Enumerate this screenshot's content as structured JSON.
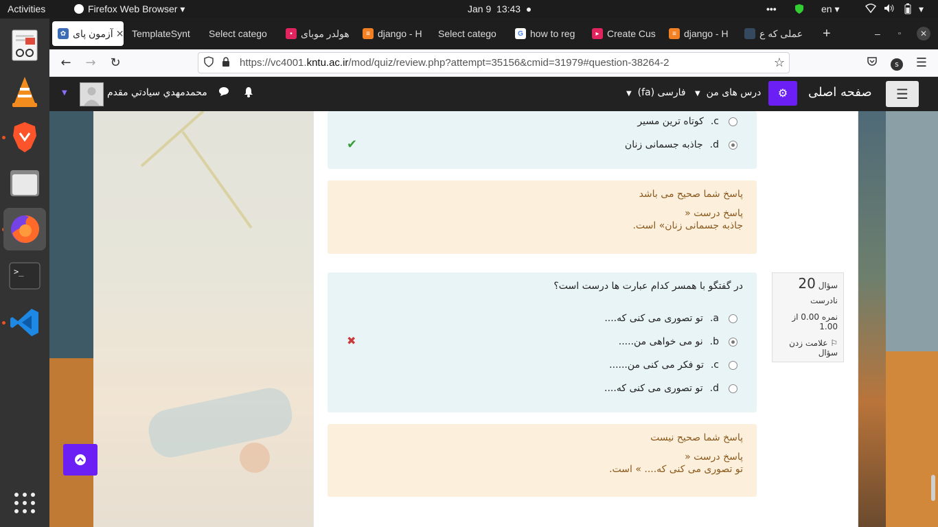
{
  "topbar": {
    "activities": "Activities",
    "app_name": "Firefox Web Browser",
    "date": "Jan 9",
    "time": "13:43",
    "language": "en"
  },
  "tabs": [
    {
      "label": "آزمون پای",
      "icon_color": "#3a6db5"
    },
    {
      "label": "TemplateSynt",
      "icon_color": "#555"
    },
    {
      "label": "Select catego",
      "icon_color": "#555"
    },
    {
      "label": "هولدر موبای",
      "icon_color": "#e0245e"
    },
    {
      "label": "django - H",
      "icon_color": "#f48024"
    },
    {
      "label": "Select catego",
      "icon_color": "#555"
    },
    {
      "label": "how to reg",
      "icon_color": "#4285f4"
    },
    {
      "label": "Create Cus",
      "icon_color": "#e0245e"
    },
    {
      "label": "django - H",
      "icon_color": "#f48024"
    },
    {
      "label": "عملی که ع",
      "icon_color": "#333"
    }
  ],
  "url": {
    "prefix": "https://vc4001.",
    "domain": "kntu.ac.ir",
    "path": "/mod/quiz/review.php?attempt=35156&cmid=31979#question-38264-2"
  },
  "moodle": {
    "home": "صفحه اصلی",
    "my_courses": "درس های من",
    "language": "فارسی (fa)",
    "user_name": "محمدمهدي سيادتي مقدم"
  },
  "q19": {
    "options": [
      {
        "letter": "c.",
        "text": "کوتاه ترین مسیر",
        "selected": false
      },
      {
        "letter": "d.",
        "text": "جاذبه جسمانی زنان",
        "selected": true
      }
    ],
    "feedback_status": "پاسخ شما صحیح می باشد",
    "correct_answer_label": "پاسخ درست «",
    "correct_answer_text": "جاذبه جسمانی زنان» است."
  },
  "q20": {
    "label": "سؤال",
    "number": "20",
    "status": "نادرست",
    "grade": "نمره 0.00 از 1.00",
    "flag": "علامت زدن سؤال",
    "question": "در گفتگو با همسر کدام عبارت ها درست است؟",
    "options": [
      {
        "letter": "a.",
        "text": "تو تصوری می کنی که....",
        "selected": false
      },
      {
        "letter": "b.",
        "text": "نو می خواهی من.....",
        "selected": true
      },
      {
        "letter": "c.",
        "text": "تو فکر می کنی من......",
        "selected": false
      },
      {
        "letter": "d.",
        "text": "تو تصوری می کنی که....",
        "selected": false
      }
    ],
    "feedback_status": "پاسخ شما صحیح نیست",
    "correct_answer_label": "پاسخ درست «",
    "correct_answer_text": "تو تصوری می کنی که....   » است."
  }
}
